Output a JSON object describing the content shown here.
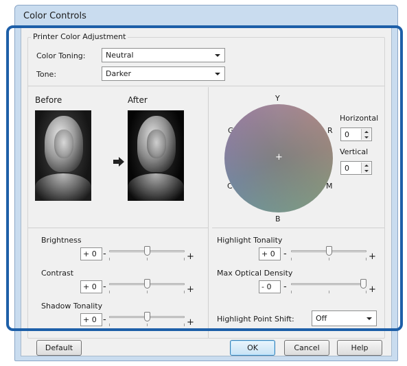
{
  "window": {
    "title": "Color Controls"
  },
  "group": {
    "label": "Printer Color Adjustment"
  },
  "color_toning": {
    "label": "Color Toning:",
    "value": "Neutral"
  },
  "tone": {
    "label": "Tone:",
    "value": "Darker"
  },
  "preview": {
    "before_label": "Before",
    "after_label": "After",
    "arrow_icon": "right-arrow"
  },
  "wheel": {
    "labels": {
      "top": "Y",
      "right": "R",
      "left": "G",
      "bottom_left": "C",
      "bottom_right": "M",
      "bottom": "B"
    },
    "center_mark": "+",
    "horizontal": {
      "label": "Horizontal",
      "value": "0"
    },
    "vertical": {
      "label": "Vertical",
      "value": "0"
    }
  },
  "sliders": {
    "brightness": {
      "label": "Brightness",
      "sign": "+",
      "value": "0",
      "level": 0.5
    },
    "contrast": {
      "label": "Contrast",
      "sign": "+",
      "value": "0",
      "level": 0.5
    },
    "shadow_tonality": {
      "label": "Shadow Tonality",
      "sign": "+",
      "value": "0",
      "level": 0.5
    },
    "highlight_tonality": {
      "label": "Highlight Tonality",
      "sign": "+",
      "value": "0",
      "level": 0.5
    },
    "max_optical_density": {
      "label": "Max Optical Density",
      "sign": "-",
      "value": "0",
      "level": 1.0
    }
  },
  "slider_ends": {
    "minus": "-",
    "plus": "+"
  },
  "highlight_point_shift": {
    "label": "Highlight Point Shift:",
    "value": "Off"
  },
  "buttons": {
    "default": "Default",
    "ok": "OK",
    "cancel": "Cancel",
    "help": "Help"
  },
  "colors": {
    "highlight_border": "#1d5fa8",
    "title_bar": "#c9dcef",
    "dialog_bg": "#f0f0f0"
  }
}
